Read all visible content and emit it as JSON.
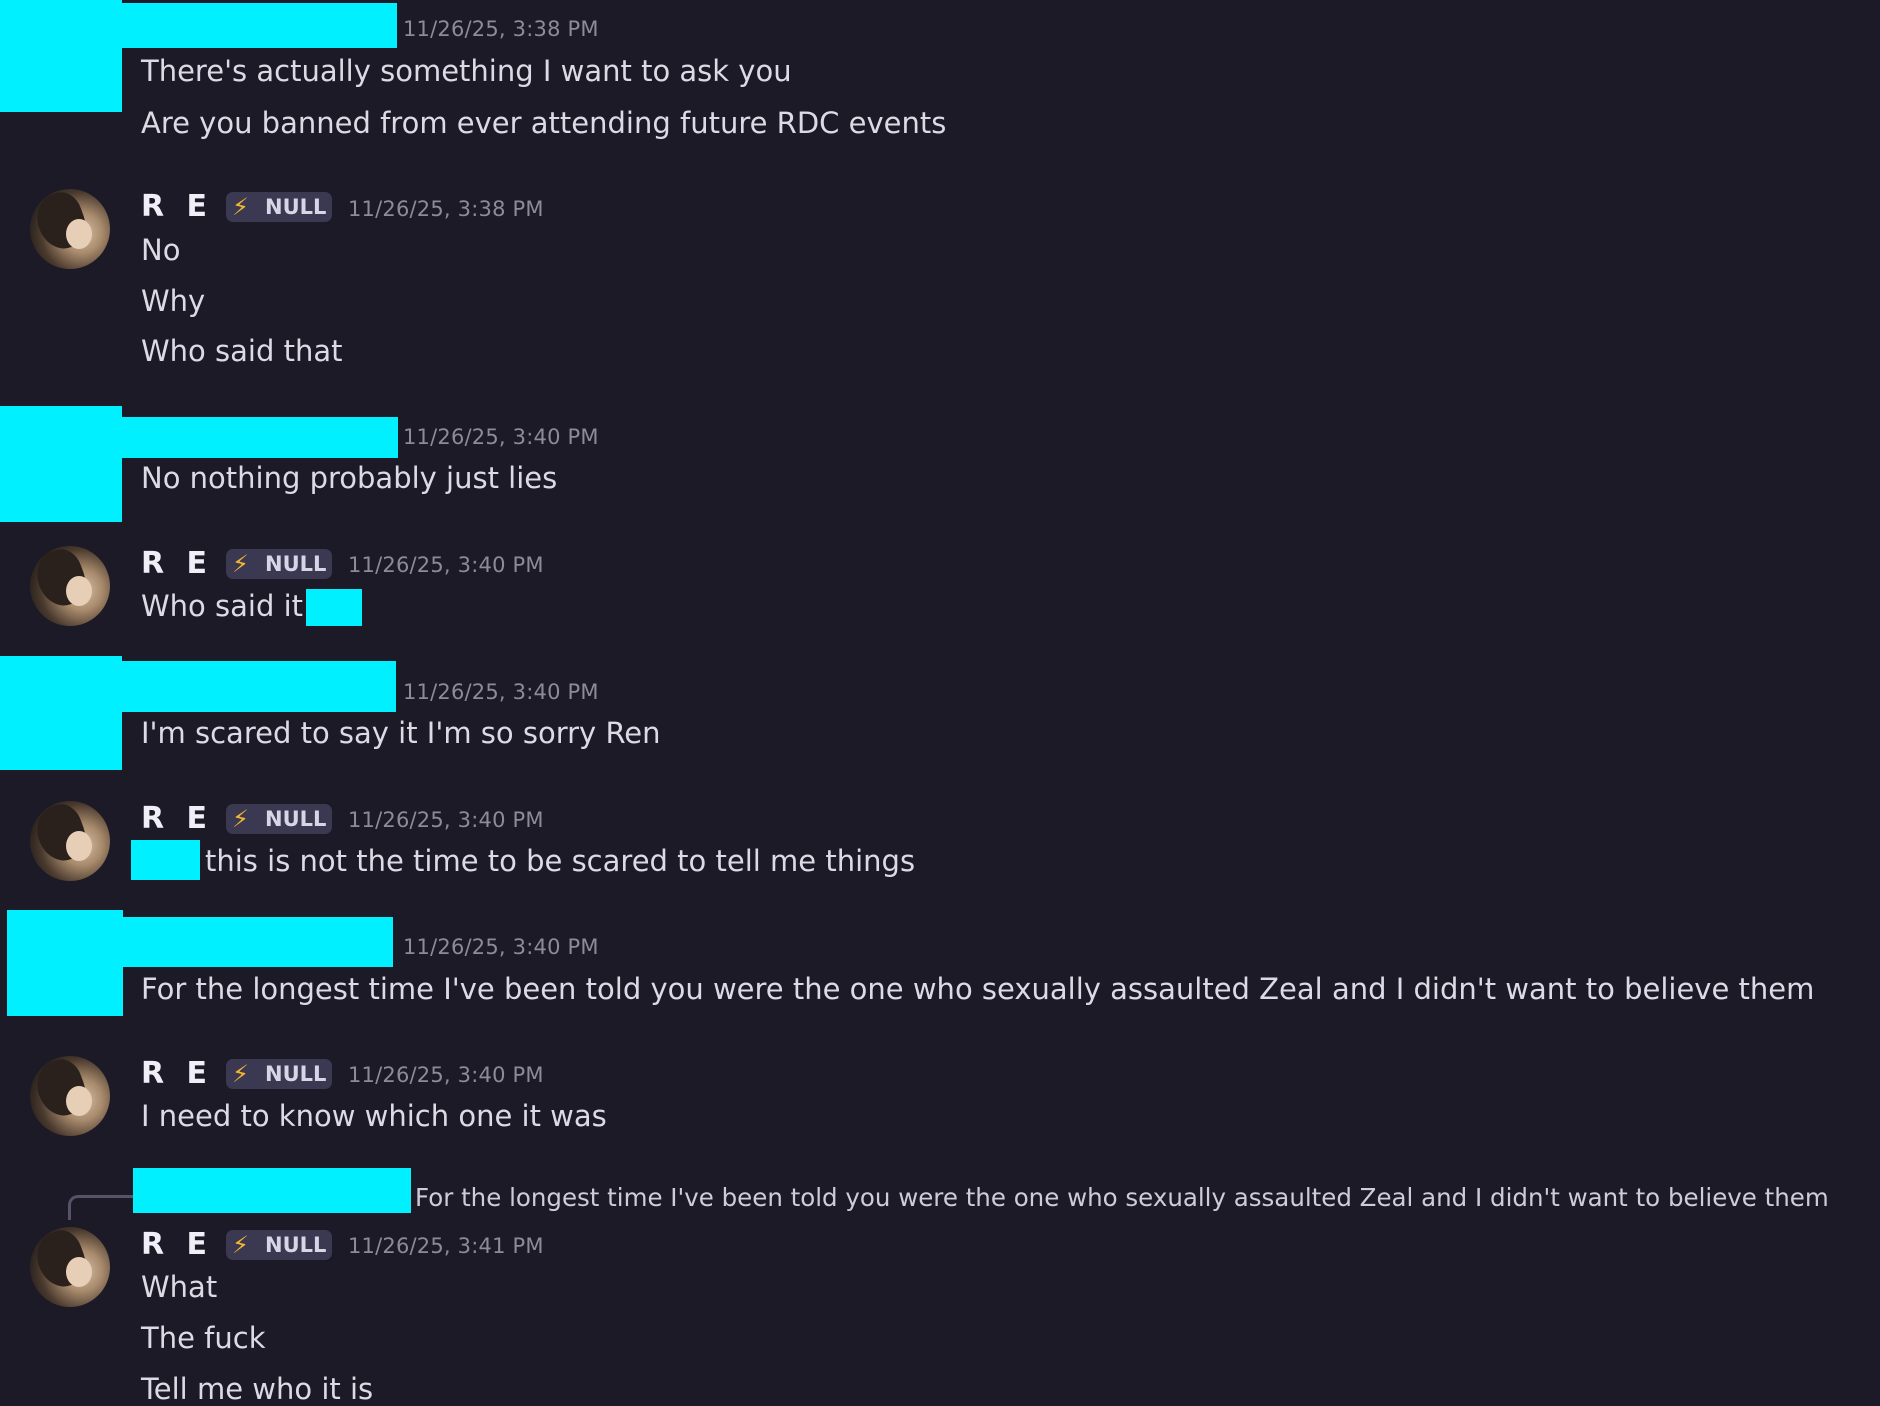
{
  "colors": {
    "background": "#1b1a26",
    "redaction": "#00f0ff",
    "timestamp": "#8e8b99",
    "badge_bg": "#3b3952",
    "bolt": "#f3b630"
  },
  "user": {
    "name": "R E N",
    "badge_icon": "lightning-bolt-icon",
    "badge_glyph": "⚡",
    "badge_text": "NULL"
  },
  "messages": [
    {
      "author": "redacted",
      "timestamp": "11/26/25, 3:38 PM",
      "lines": [
        "There's actually something I want to ask you",
        "Are you banned from ever attending future RDC events"
      ]
    },
    {
      "author": "ren",
      "timestamp": "11/26/25, 3:38 PM",
      "lines": [
        "No",
        "Why",
        "Who said that"
      ]
    },
    {
      "author": "redacted",
      "timestamp": "11/26/25, 3:40 PM",
      "lines": [
        "No nothing probably just lies"
      ]
    },
    {
      "author": "ren",
      "timestamp": "11/26/25, 3:40 PM",
      "lines": [
        "Who said it"
      ]
    },
    {
      "author": "redacted",
      "timestamp": "11/26/25, 3:40 PM",
      "lines": [
        "I'm scared to say it I'm so sorry Ren"
      ]
    },
    {
      "author": "ren",
      "timestamp": "11/26/25, 3:40 PM",
      "lines": [
        "this is not the time to be scared to tell me things"
      ]
    },
    {
      "author": "redacted",
      "timestamp": "11/26/25, 3:40 PM",
      "lines": [
        "For the longest time I've been told you were the one who sexually assaulted Zeal and I didn't want to believe them"
      ]
    },
    {
      "author": "ren",
      "timestamp": "11/26/25, 3:40 PM",
      "lines": [
        "I need to know which one it was"
      ]
    },
    {
      "author": "ren",
      "timestamp": "11/26/25, 3:41 PM",
      "reply_preview": "For the longest time I've been told you were the one who sexually assaulted Zeal and I didn't want to believe them",
      "lines": [
        "What",
        "The fuck",
        "Tell me who it is"
      ]
    }
  ]
}
